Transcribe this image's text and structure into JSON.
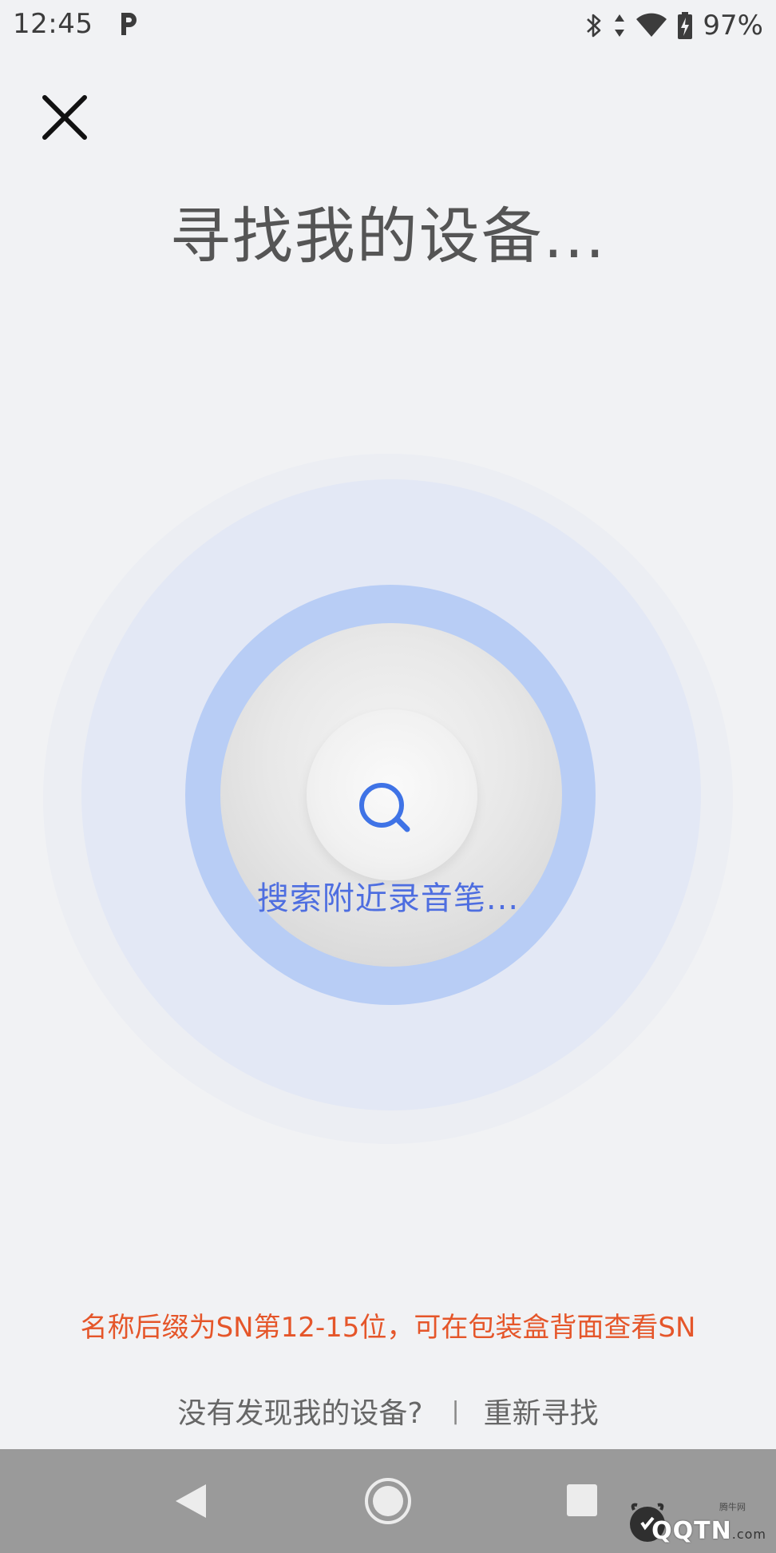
{
  "status_bar": {
    "time": "12:45",
    "battery": "97%",
    "icons": [
      "parking-p-icon",
      "bluetooth-icon",
      "data-arrows-icon",
      "wifi-icon",
      "battery-charging-icon"
    ]
  },
  "header": {
    "close_icon": "close-icon"
  },
  "title": "寻找我的设备...",
  "radar": {
    "icon": "search-icon",
    "searching_text": "搜索附近录音笔...",
    "accent_color": "#4e6ee0",
    "ring_color": "#b8cdf5"
  },
  "hint": {
    "text": "名称后缀为SN第12-15位，可在包装盒背面查看SN",
    "color": "#e5562a"
  },
  "bottom_links": {
    "not_found": "没有发现我的设备?",
    "divider": "|",
    "research": "重新寻找"
  },
  "nav_bar": {
    "icons": [
      "back-icon",
      "home-icon",
      "recents-icon"
    ]
  },
  "watermark": {
    "sub": "腾牛网",
    "text": "QQTN",
    "suffix": ".com"
  }
}
